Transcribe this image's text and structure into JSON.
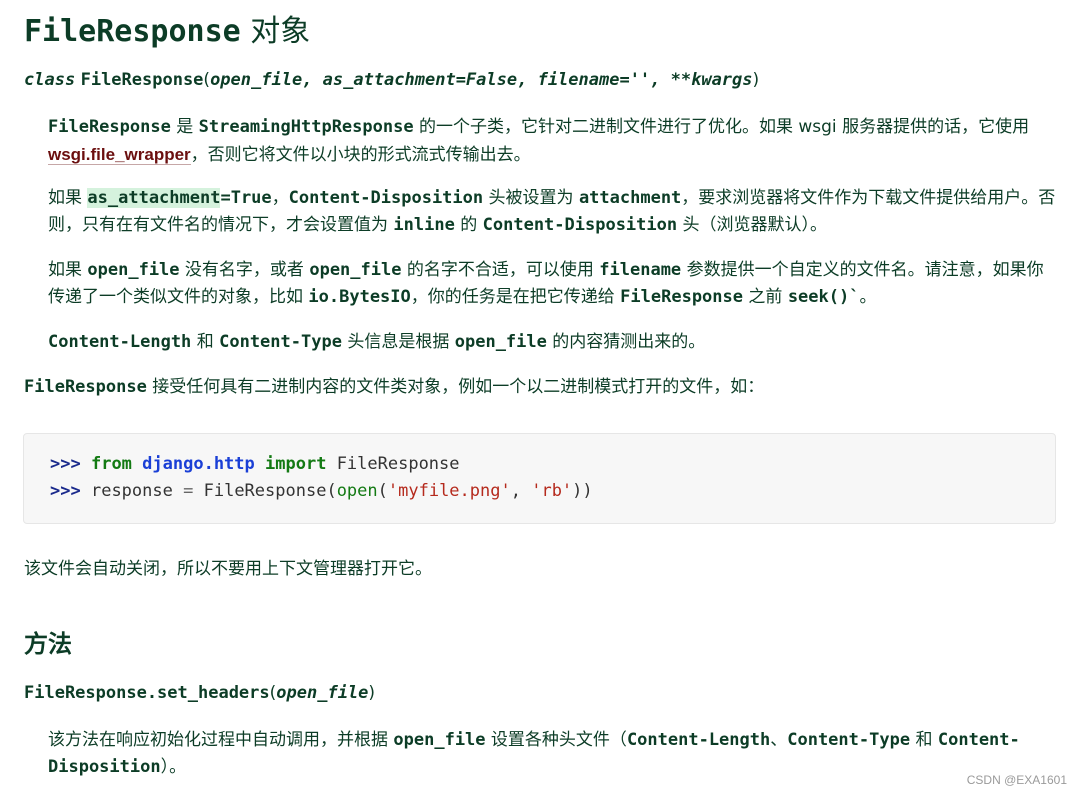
{
  "header": {
    "title_code": "FileResponse",
    "title_suffix": " 对象"
  },
  "signature": {
    "keyword": "class",
    "name": "FileResponse",
    "open_paren": "(",
    "params": "open_file, as_attachment=False, filename='', **kwargs",
    "close_paren": ")"
  },
  "paragraphs": {
    "p1": {
      "c1": "FileResponse",
      "t1": " 是 ",
      "c2": "StreamingHttpResponse",
      "t2": " 的一个子类，它针对二进制文件进行了优化。如果 wsgi 服务器提供的话，它使用 ",
      "link": "wsgi.file_wrapper",
      "t3": "，否则它将文件以小块的形式流式传输出去。"
    },
    "p2": {
      "t0": "如果 ",
      "c1": "as_attachment",
      "c1b": "=True",
      "t1": "，",
      "c2": "Content-Disposition",
      "t2": " 头被设置为 ",
      "c3": "attachment",
      "t3": "，要求浏览器将文件作为下载文件提供给用户。否则，只有在有文件名的情况下，才会设置值为 ",
      "c4": "inline",
      "t4": " 的 ",
      "c5": "Content-Disposition",
      "t5": " 头（浏览器默认）。"
    },
    "p3": {
      "t0": "如果 ",
      "c1": "open_file",
      "t1": " 没有名字，或者 ",
      "c2": "open_file",
      "t2": " 的名字不合适，可以使用 ",
      "c3": "filename",
      "t3": " 参数提供一个自定义的文件名。请注意，如果你传递了一个类似文件的对象，比如 ",
      "c4": "io.BytesIO",
      "t4": "，你的任务是在把它传递给 ",
      "c5": "FileResponse",
      "t5": " 之前 ",
      "c6": "seek()`",
      "t6": "。"
    },
    "p4": {
      "c1": "Content-Length",
      "t1": " 和 ",
      "c2": "Content-Type",
      "t2": " 头信息是根据 ",
      "c3": "open_file",
      "t3": " 的内容猜测出来的。"
    },
    "p5": {
      "c1": "FileResponse",
      "t1": " 接受任何具有二进制内容的文件类对象，例如一个以二进制模式打开的文件，如："
    },
    "p6": {
      "t1": "该文件会自动关闭，所以不要用上下文管理器打开它。"
    }
  },
  "code": {
    "line1": {
      "prompt": ">>>",
      "kw1": "from",
      "module": "django.http",
      "kw2": "import",
      "name": "FileResponse"
    },
    "line2": {
      "prompt": ">>>",
      "var": "response",
      "eq": "=",
      "cls": "FileResponse",
      "p_open": "(",
      "func": "open",
      "p_open2": "(",
      "arg1": "'myfile.png'",
      "comma": ",",
      "arg2": "'rb'",
      "p_close": "))"
    }
  },
  "methods_section": {
    "title": "方法",
    "method_name": "FileResponse.set_headers",
    "open_paren": "(",
    "param": "open_file",
    "close_paren": ")",
    "desc": {
      "t1": "该方法在响应初始化过程中自动调用，并根据 ",
      "c1": "open_file",
      "t2": " 设置各种头文件（",
      "c2": "Content-Length",
      "t3": "、",
      "c3": "Content-Type",
      "t4": " 和 ",
      "c4": "Content-Disposition",
      "t5": "）。"
    }
  },
  "watermark": "CSDN @EXA1601"
}
